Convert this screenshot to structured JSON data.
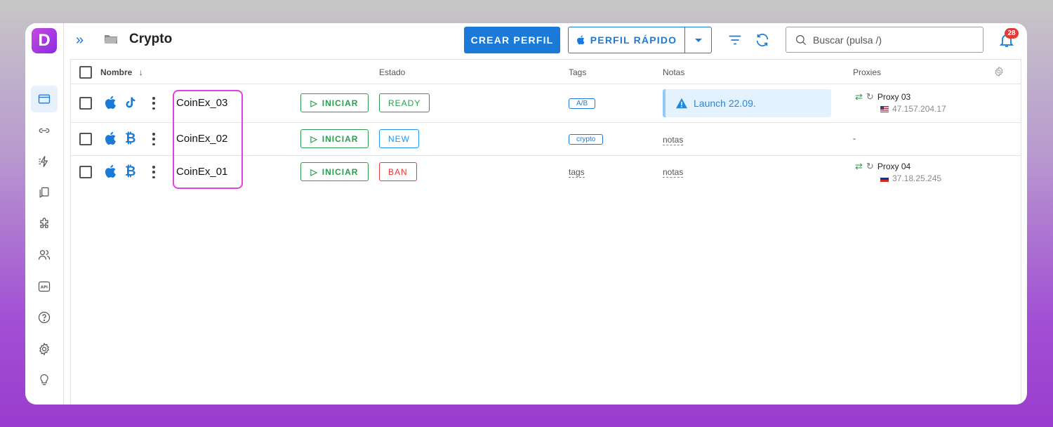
{
  "app": {
    "logo_letter": "D",
    "folder_title": "Crypto",
    "brand_color": "#1b7ad8"
  },
  "toolbar": {
    "create_label": "CREAR PERFIL",
    "quick_label": "PERFIL RÁPIDO",
    "search_placeholder": "Buscar (pulsa /)",
    "notifications_count": "28"
  },
  "sidebar": {
    "items": [
      {
        "icon": "browser-profiles-icon",
        "active": true
      },
      {
        "icon": "link-icon",
        "active": false
      },
      {
        "icon": "automation-icon",
        "active": false
      },
      {
        "icon": "bookmarks-icon",
        "active": false
      },
      {
        "icon": "extensions-icon",
        "active": false
      },
      {
        "icon": "team-icon",
        "active": false
      },
      {
        "icon": "api-icon",
        "active": false
      },
      {
        "icon": "help-icon",
        "active": false
      },
      {
        "icon": "settings-icon",
        "active": false
      },
      {
        "icon": "tips-icon",
        "active": false
      }
    ]
  },
  "table": {
    "columns": {
      "name": "Nombre",
      "status": "Estado",
      "tags": "Tags",
      "notes": "Notas",
      "proxies": "Proxies"
    },
    "rows": [
      {
        "name": "CoinEx_03",
        "start_label": "INICIAR",
        "status": "READY",
        "tag": "A/B",
        "note": "Launch 22.09.",
        "proxy_name": "Proxy 03",
        "proxy_ip": "47.157.204.17",
        "second_icon": "tiktok-icon"
      },
      {
        "name": "CoinEx_02",
        "start_label": "INICIAR",
        "status": "NEW",
        "tag": "crypto",
        "note_placeholder": "notas",
        "proxy_empty": "-",
        "second_icon": "bitcoin-icon"
      },
      {
        "name": "CoinEx_01",
        "start_label": "INICIAR",
        "status": "BAN",
        "tag_placeholder": "tags",
        "note_placeholder": "notas",
        "proxy_name": "Proxy 04",
        "proxy_ip": "37.18.25.245",
        "second_icon": "bitcoin-icon"
      }
    ]
  }
}
